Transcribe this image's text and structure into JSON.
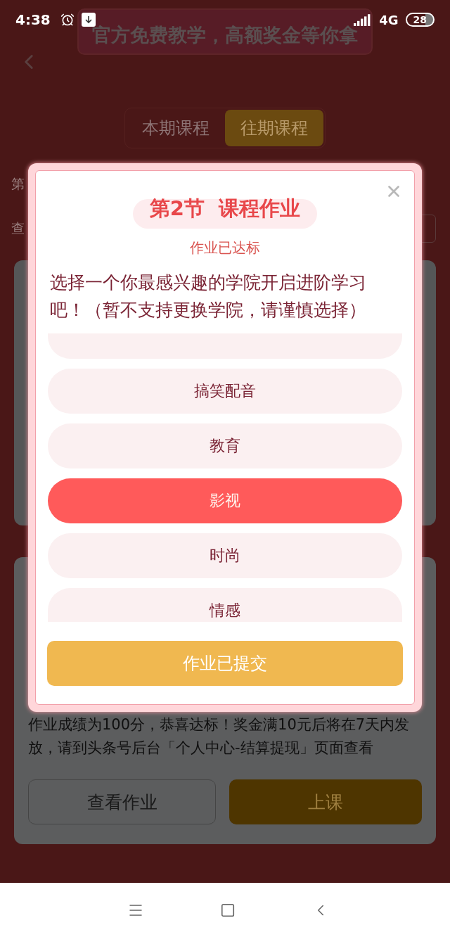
{
  "status_bar": {
    "time": "4:38",
    "network": "4G",
    "battery": "28"
  },
  "banner": {
    "slogan": "官方免费教学，高额奖金等你拿"
  },
  "tabs": [
    {
      "label": "本期课程",
      "selected": false
    },
    {
      "label": "往期课程",
      "selected": true
    }
  ],
  "background_fragments": {
    "row_1": "第",
    "row_2": "查"
  },
  "result_card": {
    "message": "作业成绩为100分，恭喜达标！奖金满10元后将在7天内发放，请到头条号后台「个人中心-结算提现」页面查看",
    "buttons": [
      {
        "label": "查看作业",
        "kind": "outline"
      },
      {
        "label": "上课",
        "kind": "primary"
      }
    ]
  },
  "dialog": {
    "title": "第2节  课程作业",
    "status": "作业已达标",
    "prompt": "选择一个你最感兴趣的学院开启进阶学习吧！（暂不支持更换学院，请谨慎选择）",
    "options": [
      {
        "label": "搞笑配音",
        "selected": false
      },
      {
        "label": "教育",
        "selected": false
      },
      {
        "label": "影视",
        "selected": true
      },
      {
        "label": "时尚",
        "selected": false
      },
      {
        "label": "情感",
        "selected": false
      }
    ],
    "submit": {
      "label": "作业已提交",
      "disabled": true
    }
  }
}
